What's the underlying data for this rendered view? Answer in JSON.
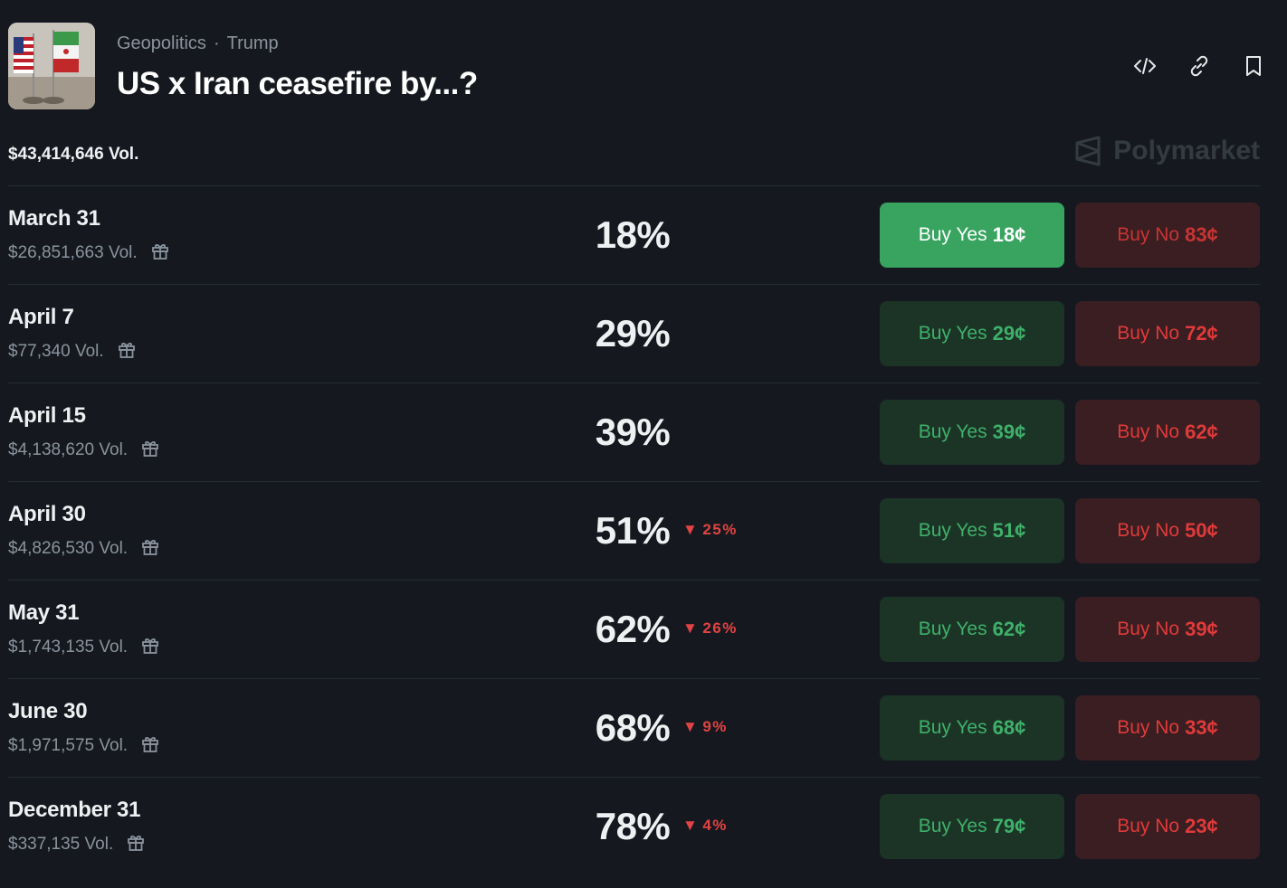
{
  "header": {
    "breadcrumbs": [
      "Geopolitics",
      "Trump"
    ],
    "separator": "·",
    "title": "US x Iran ceasefire by...?",
    "icons": [
      "embed-code-icon",
      "link-icon",
      "bookmark-icon"
    ]
  },
  "total_volume": "$43,414,646 Vol.",
  "brand": "Polymarket",
  "markets": [
    {
      "date": "March 31",
      "volume": "$26,851,663 Vol.",
      "percent": "18%",
      "change": "",
      "yes": "Buy Yes",
      "yes_price": "18¢",
      "no": "Buy No",
      "no_price": "83¢"
    },
    {
      "date": "April 7",
      "volume": "$77,340 Vol.",
      "percent": "29%",
      "change": "",
      "yes": "Buy Yes",
      "yes_price": "29¢",
      "no": "Buy No",
      "no_price": "72¢"
    },
    {
      "date": "April 15",
      "volume": "$4,138,620 Vol.",
      "percent": "39%",
      "change": "",
      "yes": "Buy Yes",
      "yes_price": "39¢",
      "no": "Buy No",
      "no_price": "62¢"
    },
    {
      "date": "April 30",
      "volume": "$4,826,530 Vol.",
      "percent": "51%",
      "change": "25%",
      "yes": "Buy Yes",
      "yes_price": "51¢",
      "no": "Buy No",
      "no_price": "50¢"
    },
    {
      "date": "May 31",
      "volume": "$1,743,135 Vol.",
      "percent": "62%",
      "change": "26%",
      "yes": "Buy Yes",
      "yes_price": "62¢",
      "no": "Buy No",
      "no_price": "39¢"
    },
    {
      "date": "June 30",
      "volume": "$1,971,575 Vol.",
      "percent": "68%",
      "change": "9%",
      "yes": "Buy Yes",
      "yes_price": "68¢",
      "no": "Buy No",
      "no_price": "33¢"
    },
    {
      "date": "December 31",
      "volume": "$337,135 Vol.",
      "percent": "78%",
      "change": "4%",
      "yes": "Buy Yes",
      "yes_price": "79¢",
      "no": "Buy No",
      "no_price": "23¢"
    }
  ],
  "colors": {
    "background": "#15191f",
    "yes_active": "#38a460",
    "yes_bg": "#1b3426",
    "yes_text": "#3fb06a",
    "no_bg": "#3a1e21",
    "no_text": "#e03a3a",
    "change_down": "#e24343"
  }
}
